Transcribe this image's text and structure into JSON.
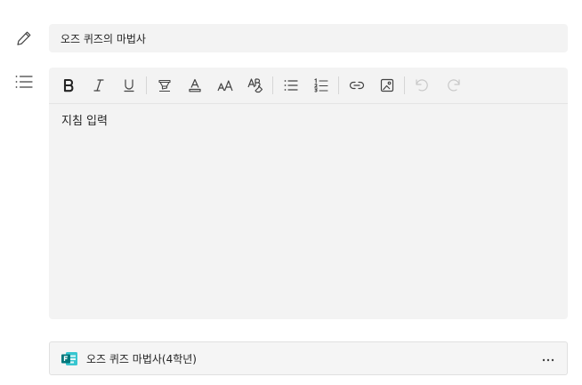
{
  "title_field": {
    "value": "오즈 퀴즈의 마법사"
  },
  "editor": {
    "placeholder": "지침 입력",
    "toolbar": [
      {
        "name": "bold-button",
        "icon": "bold-icon"
      },
      {
        "name": "italic-button",
        "icon": "italic-icon"
      },
      {
        "name": "underline-button",
        "icon": "underline-icon"
      },
      {
        "name": "highlight-button",
        "icon": "highlighter-icon"
      },
      {
        "name": "font-color-button",
        "icon": "font-color-icon"
      },
      {
        "name": "font-size-button",
        "icon": "font-size-icon"
      },
      {
        "name": "clear-formatting-button",
        "icon": "clear-formatting-icon"
      },
      {
        "name": "bullet-list-button",
        "icon": "bullet-list-icon"
      },
      {
        "name": "numbered-list-button",
        "icon": "numbered-list-icon"
      },
      {
        "name": "insert-link-button",
        "icon": "link-icon"
      },
      {
        "name": "insert-image-button",
        "icon": "image-icon"
      },
      {
        "name": "undo-button",
        "icon": "undo-icon",
        "disabled": true
      },
      {
        "name": "redo-button",
        "icon": "redo-icon",
        "disabled": true
      }
    ]
  },
  "attachment": {
    "label": "오즈 퀴즈 마법사(4학년)",
    "icon": "microsoft-forms-icon",
    "more_icon": "more-options-icon"
  },
  "colors": {
    "field_bg": "#f3f3f3",
    "forms_green": "#03787c",
    "icon_gray": "#424242",
    "disabled_gray": "#c8c8c8"
  }
}
